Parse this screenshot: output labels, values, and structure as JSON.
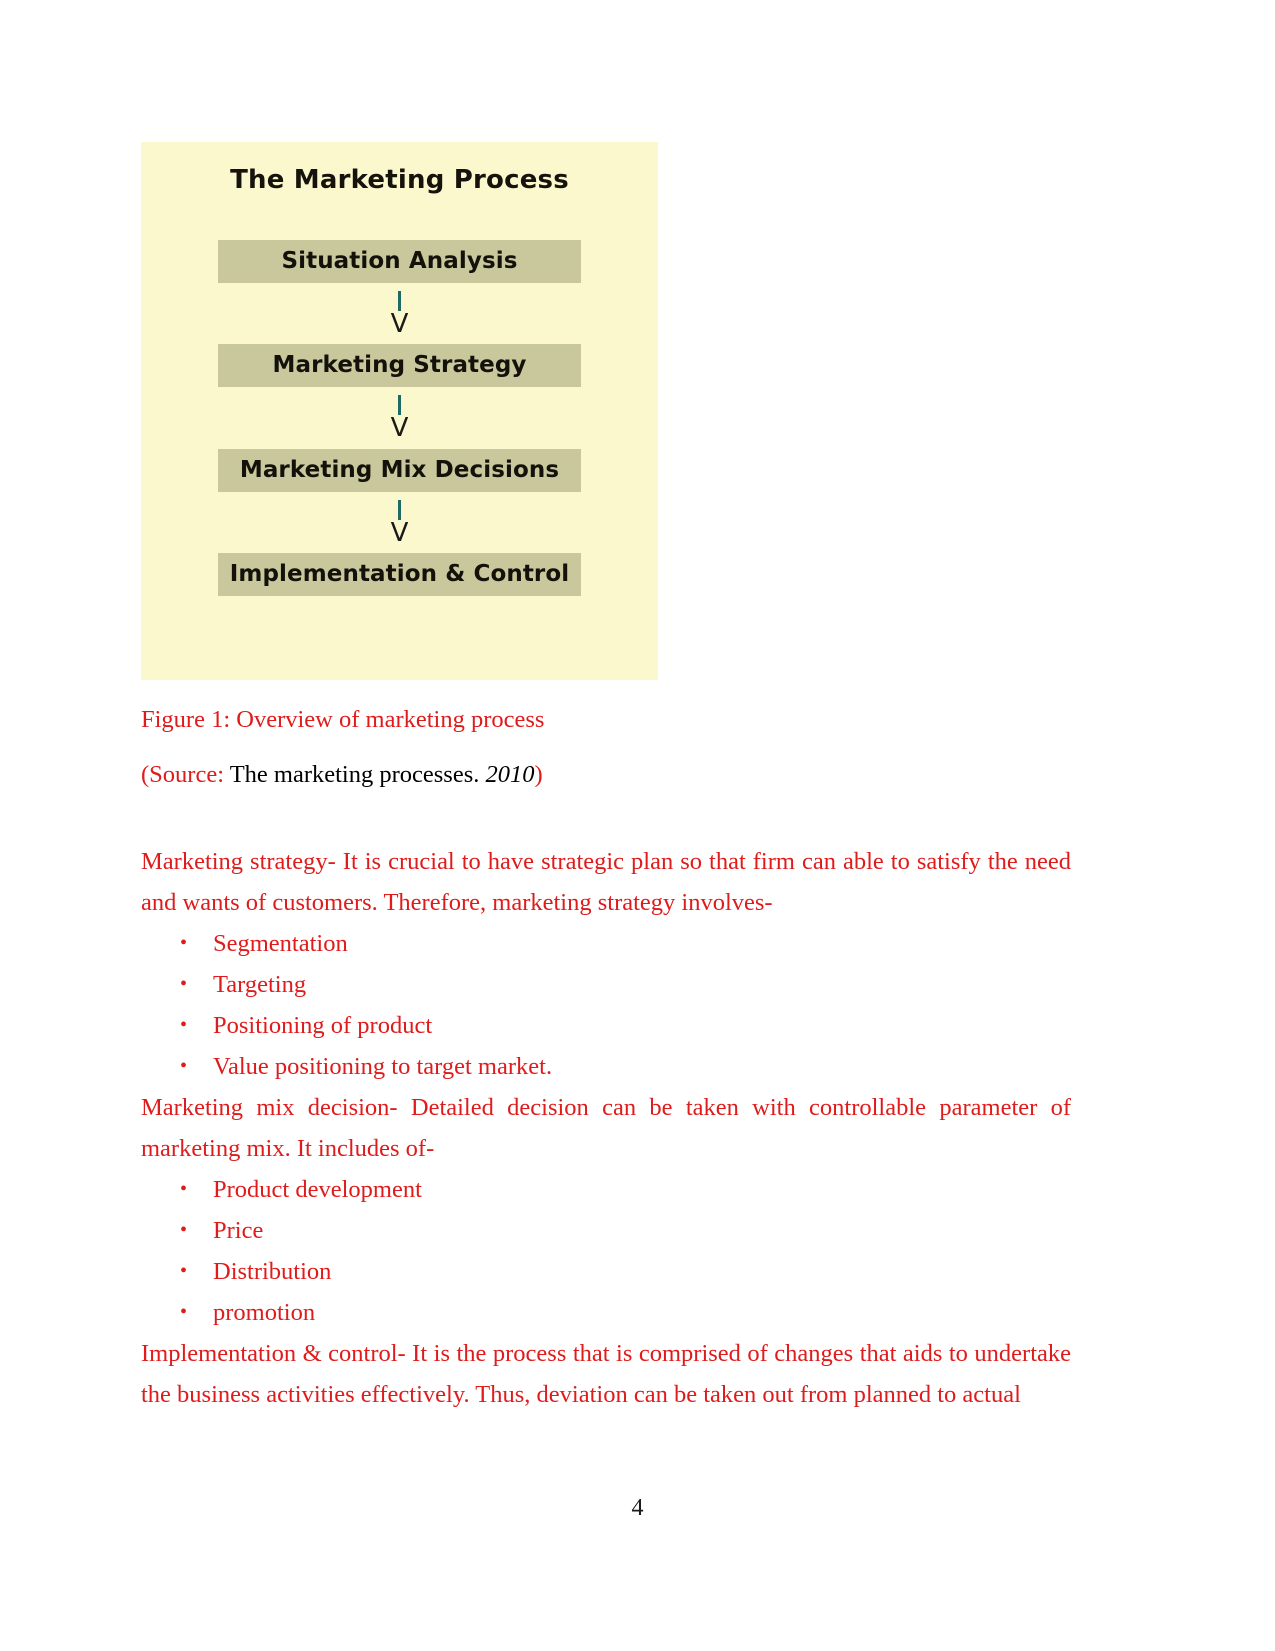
{
  "document": {
    "page_number": "4",
    "accent_color": "#e01b1b",
    "figure_bg_color": "#fbf8cd",
    "flow_box_color": "#c8c89c"
  },
  "figure": {
    "title": "The Marketing Process",
    "steps": [
      "Situation Analysis",
      "Marketing Strategy",
      "Marketing Mix Decisions",
      "Implementation & Control"
    ],
    "arrow_glyph": "V",
    "caption": "Figure 1: Overview of marketing process",
    "source": {
      "prefix": "(Source:",
      "title": "The marketing processes.",
      "year": "2010",
      "suffix": ")"
    }
  },
  "sections": [
    {
      "id": "marketing-strategy",
      "paragraph": "Marketing strategy- It is crucial to have strategic plan so that firm can able to satisfy the need and wants of customers. Therefore, marketing strategy involves-",
      "bullets": [
        "Segmentation",
        "Targeting",
        "Positioning of product",
        "Value positioning to target market."
      ]
    },
    {
      "id": "marketing-mix-decision",
      "paragraph": "Marketing mix decision- Detailed decision can be taken with controllable parameter of marketing mix. It includes of-",
      "bullets": [
        "Product development",
        "Price",
        "Distribution",
        "promotion"
      ]
    },
    {
      "id": "implementation-control",
      "paragraph": "Implementation & control- It is the process that is comprised of changes that aids to undertake the business activities effectively. Thus, deviation can be taken out from planned to actual",
      "bullets": []
    }
  ],
  "bullet_glyph": "•"
}
